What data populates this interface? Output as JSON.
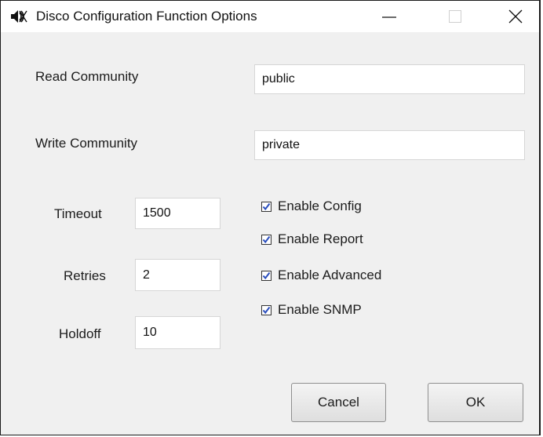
{
  "window": {
    "title": "Disco Configuration Function Options",
    "icons": {
      "app": "speaker-icon",
      "minimize": "minimize-icon",
      "maximize": "maximize-icon",
      "close": "close-icon"
    }
  },
  "fields": {
    "read_community": {
      "label": "Read Community",
      "value": "public"
    },
    "write_community": {
      "label": "Write Community",
      "value": "private"
    },
    "timeout": {
      "label": "Timeout",
      "value": "1500"
    },
    "retries": {
      "label": "Retries",
      "value": "2"
    },
    "holdoff": {
      "label": "Holdoff",
      "value": "10"
    }
  },
  "checkboxes": [
    {
      "label": "Enable Config",
      "checked": true
    },
    {
      "label": "Enable Report",
      "checked": true
    },
    {
      "label": "Enable Advanced",
      "checked": true
    },
    {
      "label": "Enable SNMP",
      "checked": true
    }
  ],
  "buttons": {
    "cancel": "Cancel",
    "ok": "OK"
  },
  "colors": {
    "check": "#2a4ebd",
    "dialog_bg": "#f0f0f0",
    "titlebar_bg": "#ffffff"
  }
}
